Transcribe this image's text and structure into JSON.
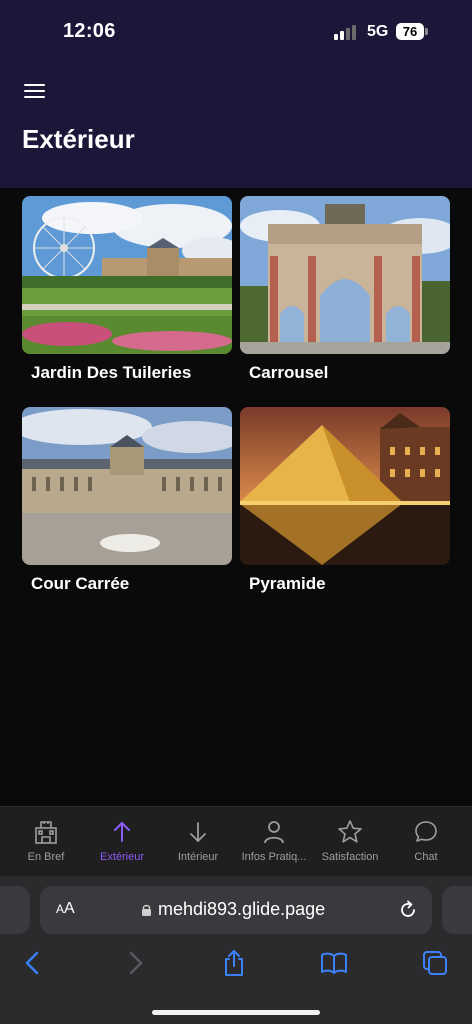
{
  "status_bar": {
    "time": "12:06",
    "network": "5G",
    "battery": "76"
  },
  "header": {
    "title": "Extérieur",
    "menu_icon": "hamburger-menu-icon"
  },
  "places": [
    {
      "label": "Jardin Des Tuileries",
      "image": "tuileries-garden-ferris-wheel"
    },
    {
      "label": "Carrousel",
      "image": "arc-de-triomphe-du-carrousel"
    },
    {
      "label": "Cour Carrée",
      "image": "cour-carree-courtyard"
    },
    {
      "label": "Pyramide",
      "image": "louvre-pyramid-at-night"
    }
  ],
  "tabs": [
    {
      "label": "En Bref",
      "icon": "castle-icon",
      "active": false
    },
    {
      "label": "Extérieur",
      "icon": "arrow-up-icon",
      "active": true
    },
    {
      "label": "Intérieur",
      "icon": "arrow-down-icon",
      "active": false
    },
    {
      "label": "Infos Pratiq...",
      "icon": "person-icon",
      "active": false
    },
    {
      "label": "Satisfaction",
      "icon": "star-icon",
      "active": false
    },
    {
      "label": "Chat",
      "icon": "chat-bubble-icon",
      "active": false
    }
  ],
  "browser": {
    "text_size_label_small": "A",
    "text_size_label_large": "A",
    "url": "mehdi893.glide.page"
  },
  "colors": {
    "header_bg": "#1e1638",
    "accent": "#8b5cf6",
    "tab_inactive": "#9e9e9e",
    "browser_blue": "#3b82f6"
  }
}
